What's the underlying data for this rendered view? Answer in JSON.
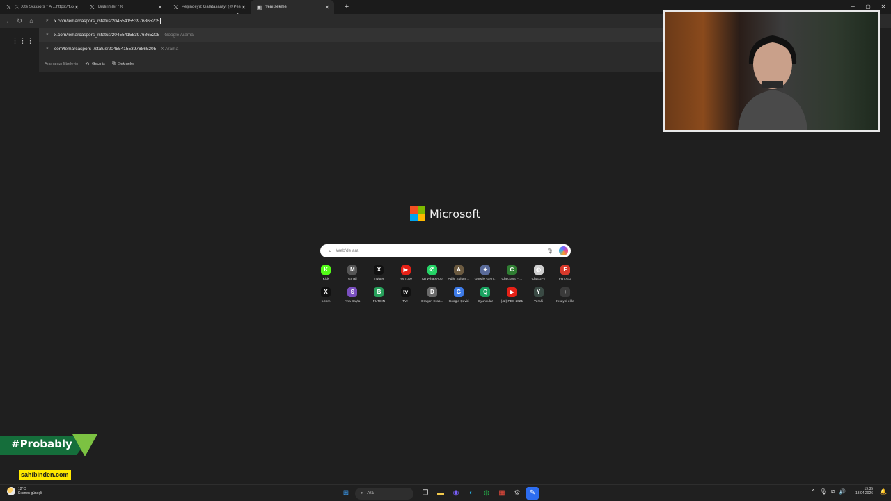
{
  "tabs": [
    {
      "label": "(1) X'te Scissors ^ A ...https://t.co/...",
      "icon": "x-icon",
      "active": false
    },
    {
      "label": "Bildirimler / X",
      "icon": "x-icon",
      "active": false
    },
    {
      "label": "Peşindeyiz Galatasaray! (@Pesinde...",
      "icon": "x-icon",
      "active": false
    },
    {
      "label": "Yeni sekme",
      "icon": "newtab-icon",
      "active": true
    }
  ],
  "address": {
    "value": "x.com/lemarcaspors_/status/2045541553976865205"
  },
  "suggestions": [
    {
      "text": "x.com/lemarcaspors_/status/2045541553976865205",
      "hint": "- Google Arama"
    },
    {
      "text": "com/lemarcaspors_/status/2045541553976865205",
      "hint": "- X Arama"
    }
  ],
  "filters": {
    "label": "Aramanızı filtreleyin",
    "history": "Geçmiş",
    "tabs": "Sekmeler"
  },
  "brand": {
    "name": "Microsoft",
    "colors": [
      "#f25022",
      "#7fba00",
      "#00a4ef",
      "#ffb900"
    ]
  },
  "search": {
    "placeholder": "Web'de ara"
  },
  "quicklinks_row1": [
    {
      "label": "Kick",
      "color": "#53fc18",
      "glyph": "K"
    },
    {
      "label": "Gmail",
      "color": "#555555",
      "glyph": "M"
    },
    {
      "label": "Twitter",
      "color": "#111111",
      "glyph": "X"
    },
    {
      "label": "YouTube",
      "color": "#e62117",
      "glyph": "▶"
    },
    {
      "label": "(3) WhatsApp",
      "color": "#25d366",
      "glyph": "✆"
    },
    {
      "label": "Adile Sultan ...",
      "color": "#6b5a40",
      "glyph": "A"
    },
    {
      "label": "Google Gem...",
      "color": "#5a6b9a",
      "glyph": "✦"
    },
    {
      "label": "Checkout Fr...",
      "color": "#2f7d32",
      "glyph": "C"
    },
    {
      "label": "ChatGPT",
      "color": "#cfcfcf",
      "glyph": "◎"
    },
    {
      "label": "FUT.GG",
      "color": "#d8392b",
      "glyph": "F"
    }
  ],
  "quicklinks_row2": [
    {
      "label": "x.com",
      "color": "#111111",
      "glyph": "X"
    },
    {
      "label": "Ana Sayfa",
      "color": "#7a4fbf",
      "glyph": "S"
    },
    {
      "label": "FUTBIN",
      "color": "#27a15b",
      "glyph": "B"
    },
    {
      "label": "TV+",
      "color": "#111111",
      "glyph": "tv"
    },
    {
      "label": "Dragon Cras...",
      "color": "#6a6a6a",
      "glyph": "D"
    },
    {
      "label": "Google Çeviri",
      "color": "#3d7be8",
      "glyph": "G"
    },
    {
      "label": "Oyuncular",
      "color": "#1aa260",
      "glyph": "Q"
    },
    {
      "label": "(42) PES 2021",
      "color": "#e62117",
      "glyph": "▶"
    },
    {
      "label": "Yeralti",
      "color": "#3a4a44",
      "glyph": "Y"
    },
    {
      "label": "Kısayol ekle",
      "color": "#3a3a3a",
      "glyph": "+"
    }
  ],
  "overlay": {
    "hashtag": "#Probably",
    "sponsor": "sahibinden.com"
  },
  "taskbar": {
    "weather_temp": "12°C",
    "weather_desc": "Kısmen güneşli",
    "search_label": "Ara",
    "time": "19:35",
    "date": "18.04.2026"
  }
}
